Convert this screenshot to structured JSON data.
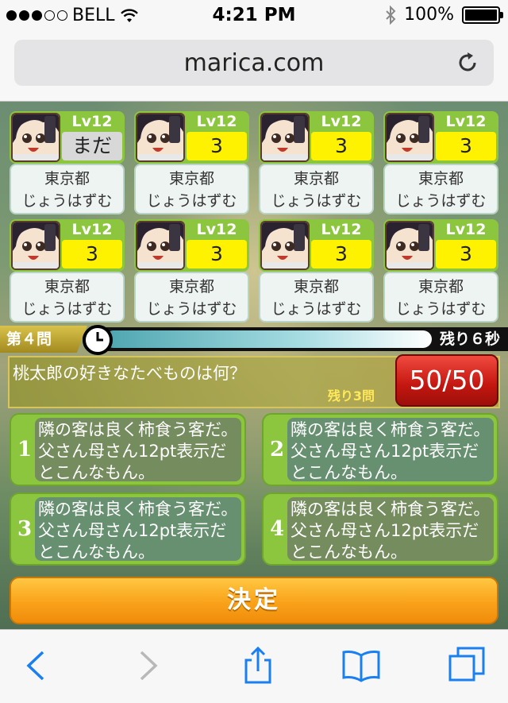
{
  "status_bar": {
    "carrier": "BELL",
    "signal_dots_filled": 3,
    "signal_dots_total": 5,
    "time": "4:21 PM",
    "battery": "100%",
    "battery_level": 1.0
  },
  "browser": {
    "url": "marica.com",
    "icons": {
      "reload": "reload-icon",
      "back": "back-icon",
      "forward": "forward-icon",
      "share": "share-icon",
      "bookmarks": "bookmarks-icon",
      "tabs": "tabs-icon"
    }
  },
  "players": [
    {
      "level": "Lv12",
      "score": "まだ",
      "prefecture": "東京都",
      "name": "じょうはずむ"
    },
    {
      "level": "Lv12",
      "score": "3",
      "prefecture": "東京都",
      "name": "じょうはずむ"
    },
    {
      "level": "Lv12",
      "score": "3",
      "prefecture": "東京都",
      "name": "じょうはずむ"
    },
    {
      "level": "Lv12",
      "score": "3",
      "prefecture": "東京都",
      "name": "じょうはずむ"
    },
    {
      "level": "Lv12",
      "score": "3",
      "prefecture": "東京都",
      "name": "じょうはずむ"
    },
    {
      "level": "Lv12",
      "score": "3",
      "prefecture": "東京都",
      "name": "じょうはずむ"
    },
    {
      "level": "Lv12",
      "score": "3",
      "prefecture": "東京都",
      "name": "じょうはずむ"
    },
    {
      "level": "Lv12",
      "score": "3",
      "prefecture": "東京都",
      "name": "じょうはずむ"
    }
  ],
  "quiz": {
    "question_number": "第４問",
    "time_remaining": "残り６秒",
    "timer_fraction": 0.82,
    "question": "桃太郎の好きなたべものは何？",
    "questions_left": "残り3問",
    "counter": "50/50",
    "answers": [
      {
        "number": "1",
        "text": "隣の客は良く柿食う客だ。父さん母さん12pt表示だとこんなもん。"
      },
      {
        "number": "2",
        "text": "隣の客は良く柿食う客だ。父さん母さん12pt表示だとこんなもん。"
      },
      {
        "number": "3",
        "text": "隣の客は良く柿食う客だ。父さん母さん12pt表示だとこんなもん。"
      },
      {
        "number": "4",
        "text": "隣の客は良く柿食う客だ。父さん母さん12pt表示だとこんなもん。"
      }
    ],
    "submit_label": "決定"
  },
  "colors": {
    "player_green": "#8cc63f",
    "score_yellow": "#fff200",
    "counter_red": "#c41610",
    "submit_orange": "#f9a21a",
    "ios_blue": "#1a7ff0"
  }
}
